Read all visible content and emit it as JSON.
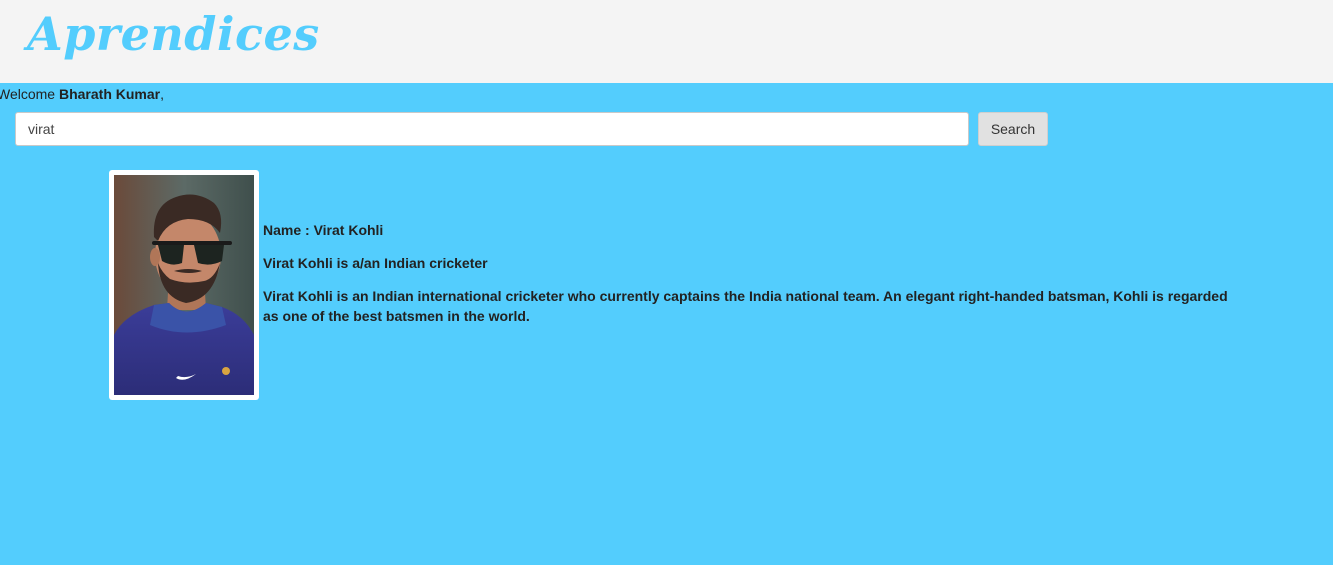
{
  "header": {
    "logo": "Aprendices"
  },
  "welcome": {
    "prefix": "Welcome ",
    "user_name": "Bharath Kumar",
    "suffix": ","
  },
  "search": {
    "value": "virat",
    "button_label": "Search"
  },
  "result": {
    "name_line": "Name : Virat Kohli",
    "summary": "Virat Kohli is a/an Indian cricketer",
    "description": "Virat Kohli is an Indian international cricketer who currently captains the India national team. An elegant right-handed batsman, Kohli is regarded as one of the best batsmen in the world."
  },
  "colors": {
    "background": "#53cdfd",
    "header_bg": "#f4f4f4",
    "logo": "#53cdfd"
  }
}
